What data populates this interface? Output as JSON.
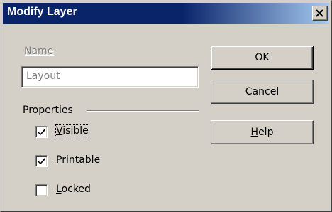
{
  "window": {
    "title": "Modify Layer",
    "close_icon": "close-icon"
  },
  "name_field": {
    "label": "Name",
    "value": "Layout"
  },
  "properties": {
    "title": "Properties",
    "checkboxes": [
      {
        "label_accel": "V",
        "label_rest": "isible",
        "checked": true
      },
      {
        "label_accel": "P",
        "label_rest": "rintable",
        "checked": true
      },
      {
        "label_accel": "L",
        "label_rest": "ocked",
        "checked": false
      }
    ]
  },
  "buttons": {
    "ok": "OK",
    "cancel": "Cancel",
    "help_accel": "H",
    "help_rest": "elp"
  }
}
